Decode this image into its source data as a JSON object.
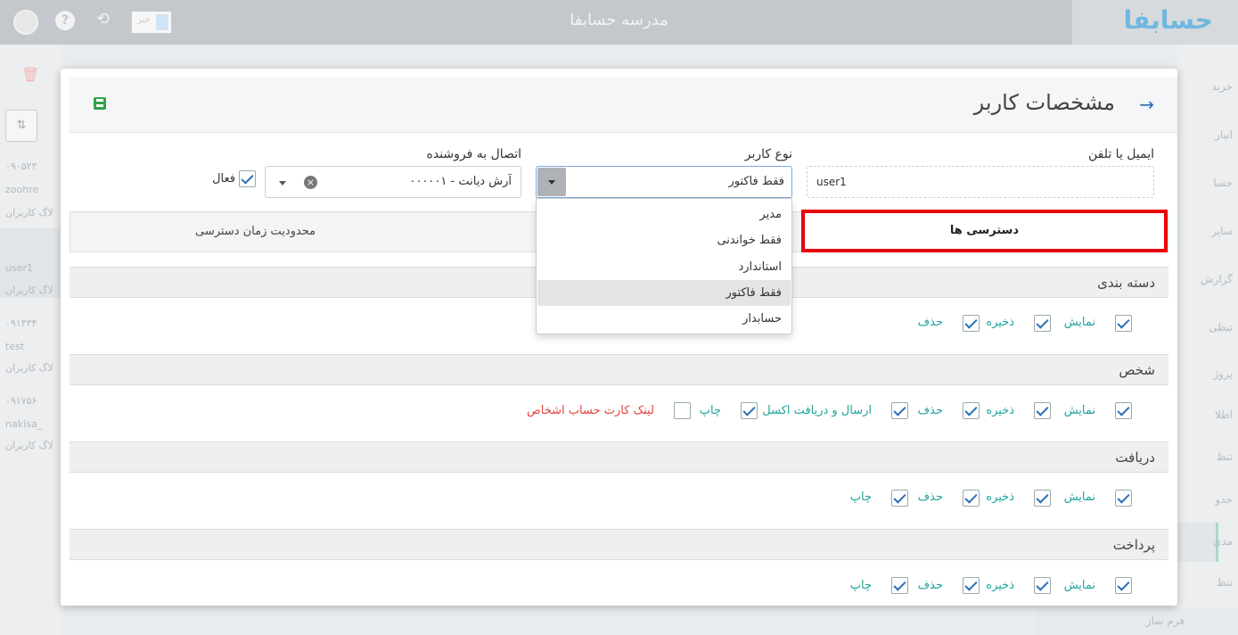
{
  "topbar": {
    "title": "مدرسه حسابفا",
    "logo": "حسابفا",
    "news_label": "خبر"
  },
  "background_left": {
    "items": [
      "۰۹۰۵۲۳",
      "zoohre",
      "لاگ کاربران",
      "user1",
      "لاگ کاربران",
      "۰۹۱۳۳۴",
      "test",
      "لاگ کاربران",
      "۰۹۱۷۵۶",
      "nakisa_",
      "لاگ کاربران"
    ]
  },
  "background_right": {
    "items": [
      "خرید",
      "انبار",
      "حسا",
      "سایر",
      "گزارش",
      "تنظی",
      "پروژ",
      "اطلا",
      "تنظ",
      "جدو",
      "مدی",
      "تنظ"
    ],
    "bottom_item": "فرم ساز"
  },
  "modal": {
    "title": "مشخصات کاربر",
    "email": {
      "label": "ایمیل یا تلفن",
      "value": "user1"
    },
    "user_type": {
      "label": "نوع کاربر",
      "value": "فقط فاکتور",
      "options": [
        "مدیر",
        "فقط خواندنی",
        "استاندارد",
        "فقط فاکتور",
        "حسابدار"
      ]
    },
    "seller": {
      "label": "اتصال به فروشنده",
      "value": "۰۰۰۰۰۱ - آرش دیانت"
    },
    "active_label": "فعال",
    "tabs": {
      "access": "دسترسی ها",
      "time_limit": "محدودیت زمان دسترسی"
    },
    "sections": [
      {
        "title": "دسته بندی",
        "perms": [
          "نمایش",
          "ذخیره",
          "حذف"
        ]
      },
      {
        "title": "شخص",
        "perms": [
          "نمایش",
          "ذخیره",
          "حذف",
          "ارسال و دریافت اکسل",
          "چاپ",
          "لینک کارت حساب اشخاص"
        ]
      },
      {
        "title": "دریافت",
        "perms": [
          "نمایش",
          "ذخیره",
          "حذف",
          "چاپ"
        ]
      },
      {
        "title": "پرداخت",
        "perms": [
          "نمایش",
          "ذخیره",
          "حذف",
          "چاپ"
        ]
      }
    ]
  }
}
